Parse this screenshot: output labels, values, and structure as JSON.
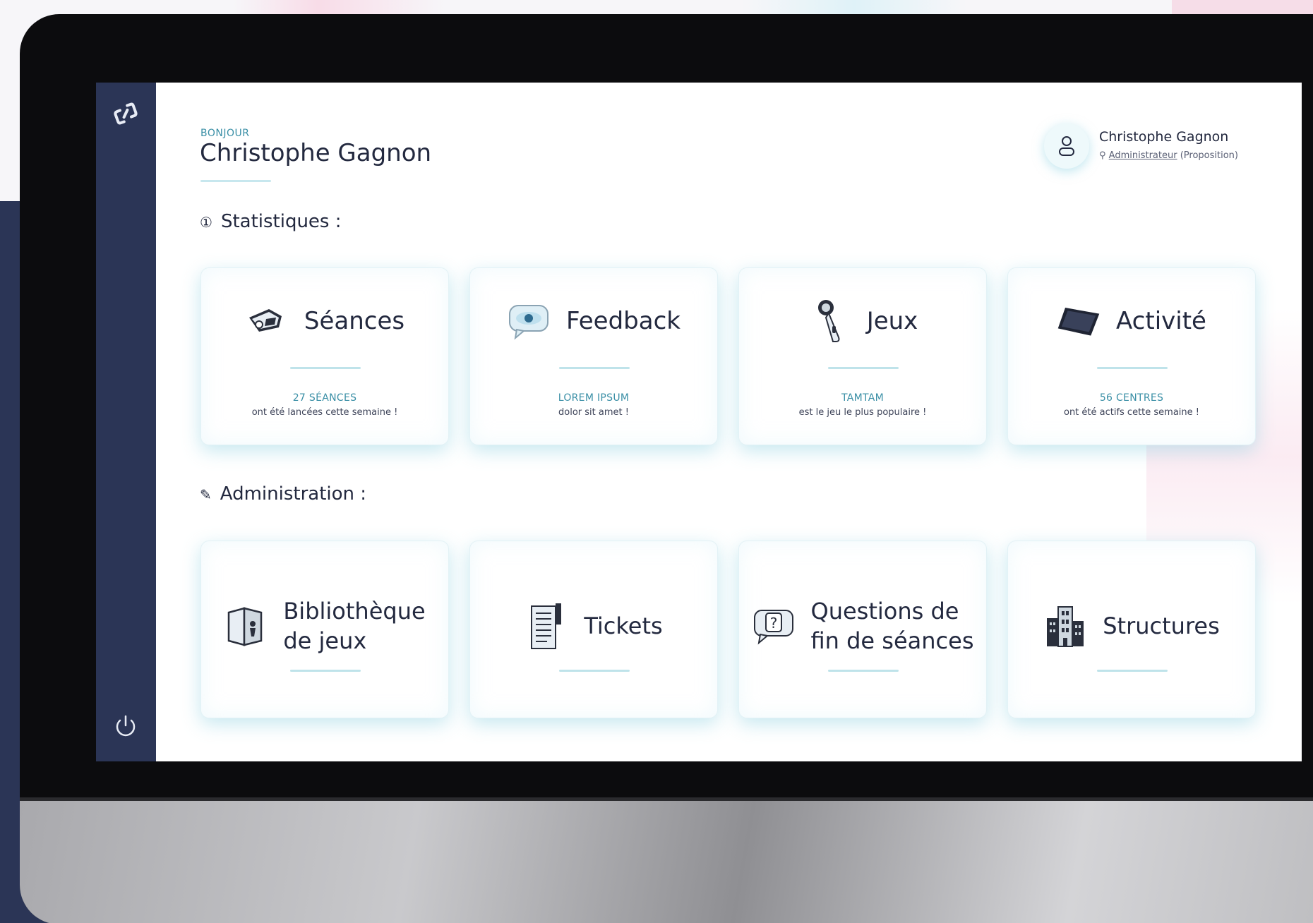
{
  "greeting": {
    "small": "BONJOUR",
    "name": "Christophe Gagnon"
  },
  "user": {
    "avatar_icon": "user-icon",
    "name": "Christophe Gagnon",
    "role_icon": "badge-icon",
    "role": "Administrateur",
    "role_suffix": "(Proposition)"
  },
  "sidebar": {
    "logo": "ᔕ",
    "logo_icon": "app-logo-icon",
    "logout_icon": "power-icon"
  },
  "sections": {
    "stats_icon": "①",
    "stats_title": "Statistiques :",
    "admin_icon": "✎",
    "admin_title": "Administration :"
  },
  "stats_cards": [
    {
      "title": "Séances",
      "icon": "vr-headset-icon",
      "stat_top": "27 SÉANCES",
      "stat_bottom": "ont été lancées cette semaine !"
    },
    {
      "title": "Feedback",
      "icon": "chat-bubble-icon",
      "stat_top": "LOREM IPSUM",
      "stat_bottom": "dolor sit amet !"
    },
    {
      "title": "Jeux",
      "icon": "vr-controller-icon",
      "stat_top": "TAMTAM",
      "stat_bottom": "est le jeu le plus populaire !"
    },
    {
      "title": "Activité",
      "icon": "tablet-icon",
      "stat_top": "56 CENTRES",
      "stat_bottom": "ont été actifs cette semaine !"
    }
  ],
  "admin_cards": [
    {
      "line1": "Bibliothèque",
      "line2": "de jeux",
      "icon": "game-library-icon"
    },
    {
      "line1": "Tickets",
      "line2": "",
      "icon": "ticket-document-icon"
    },
    {
      "line1": "Questions de",
      "line2": "fin de séances",
      "icon": "question-bubble-icon"
    },
    {
      "line1": "Structures",
      "line2": "",
      "icon": "buildings-icon"
    }
  ],
  "colors": {
    "sidebar": "#2b3556",
    "accent": "#3a8fa6",
    "text": "#23293f",
    "card_glow": "#82cdde"
  }
}
